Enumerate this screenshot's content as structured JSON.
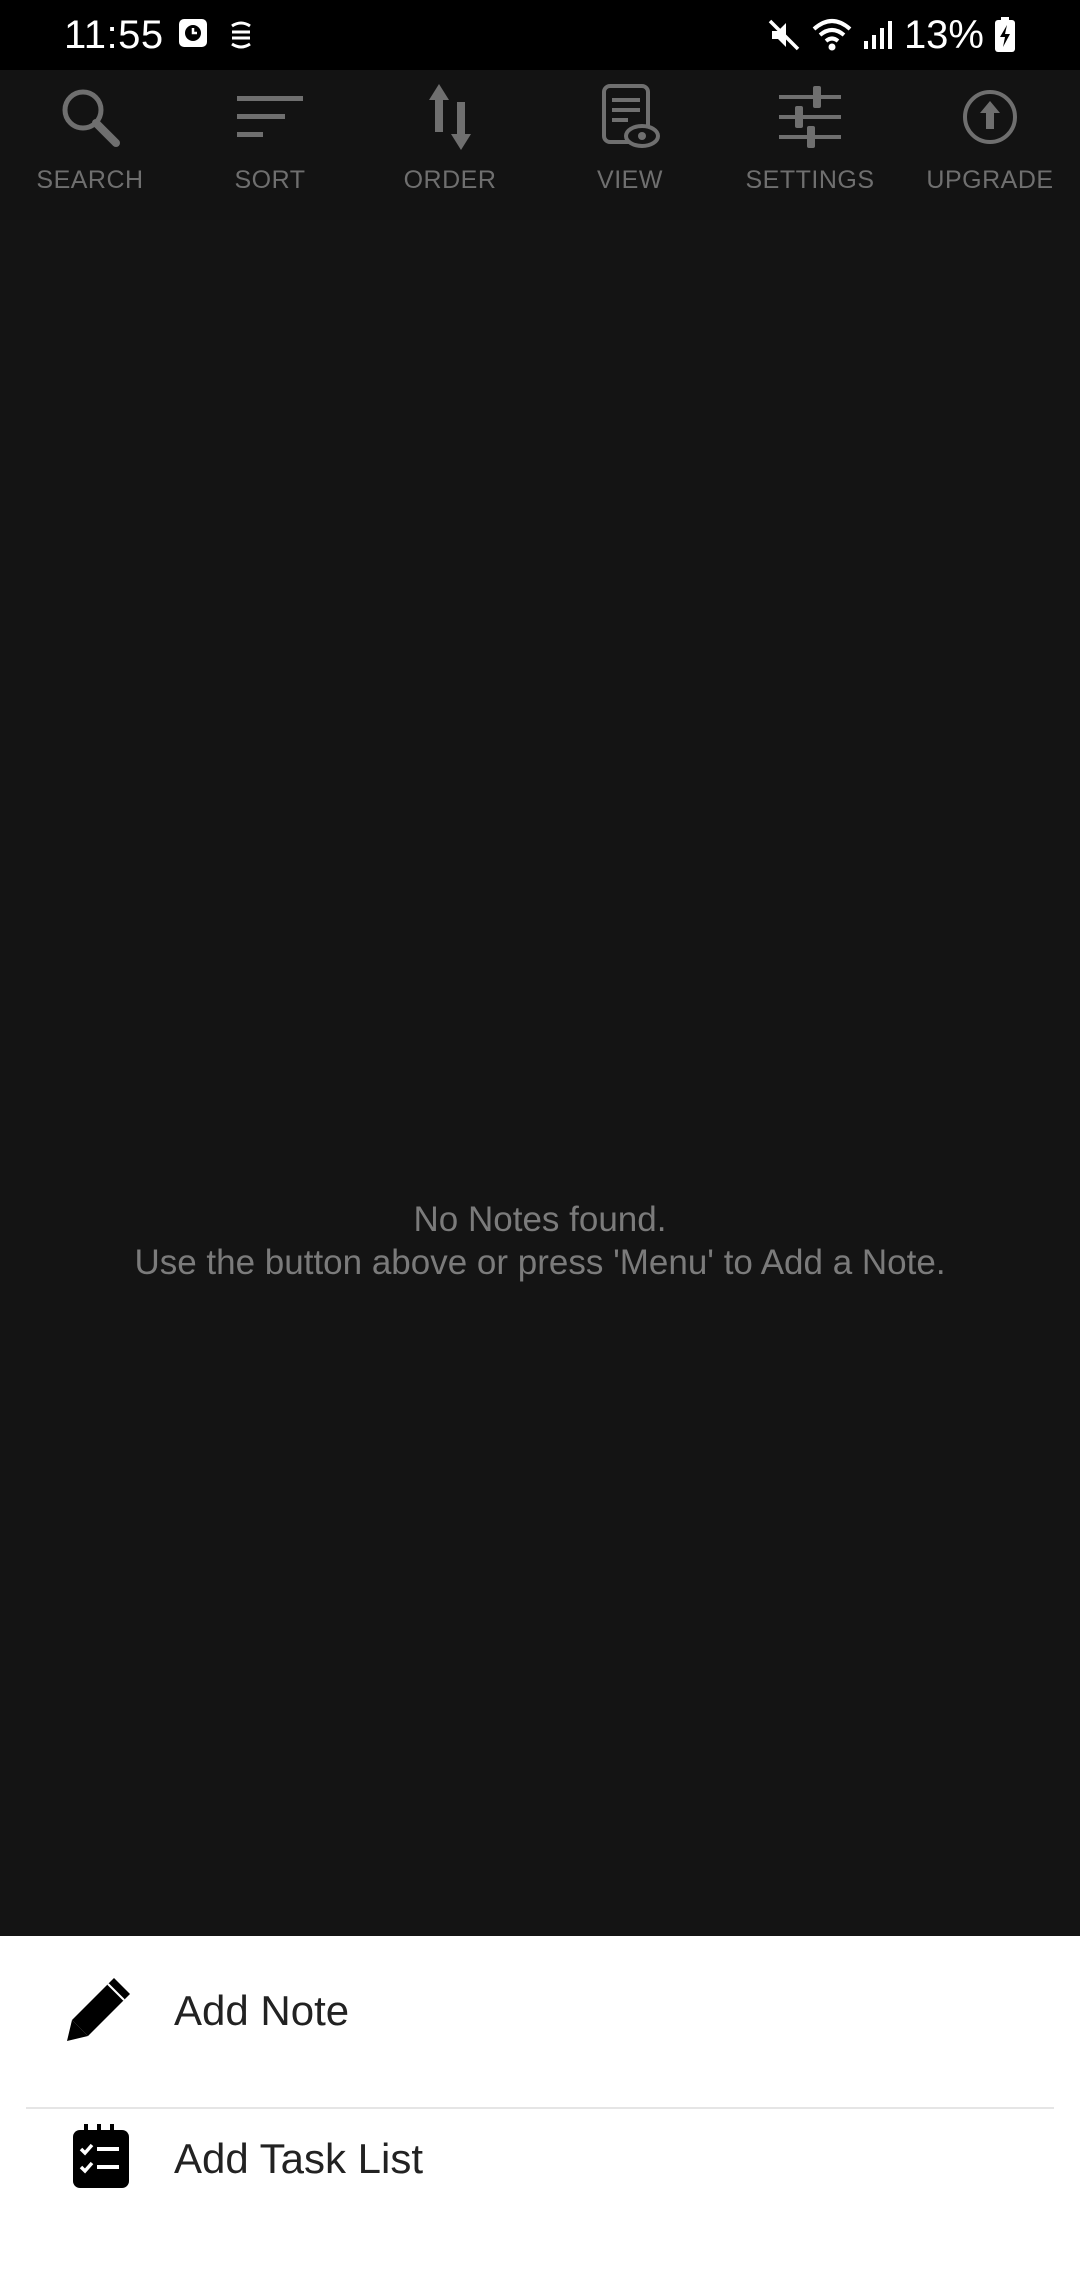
{
  "status_bar": {
    "time": "11:55",
    "battery": "13%",
    "icons": [
      "alarm-icon",
      "sync-icon",
      "mute-icon",
      "wifi-icon",
      "signal-icon",
      "battery-charging-icon"
    ]
  },
  "toolbar": {
    "items": [
      {
        "label": "SEARCH",
        "icon": "search-icon"
      },
      {
        "label": "SORT",
        "icon": "sort-icon"
      },
      {
        "label": "ORDER",
        "icon": "order-icon"
      },
      {
        "label": "VIEW",
        "icon": "view-icon"
      },
      {
        "label": "SETTINGS",
        "icon": "settings-icon"
      },
      {
        "label": "UPGRADE",
        "icon": "upgrade-icon"
      }
    ]
  },
  "empty_state": {
    "line1": "No Notes found.",
    "line2": "Use the button above or press 'Menu' to Add a Note."
  },
  "sheet": {
    "items": [
      {
        "label": "Add Note",
        "icon": "pencil-icon"
      },
      {
        "label": "Add Task List",
        "icon": "task-list-icon"
      }
    ]
  },
  "colors": {
    "toolbar_bg": "#131313",
    "main_bg": "#141414",
    "toolbar_icon": "#6f6f6f",
    "empty_text": "#7b7b7b",
    "sheet_bg": "#ffffff"
  }
}
